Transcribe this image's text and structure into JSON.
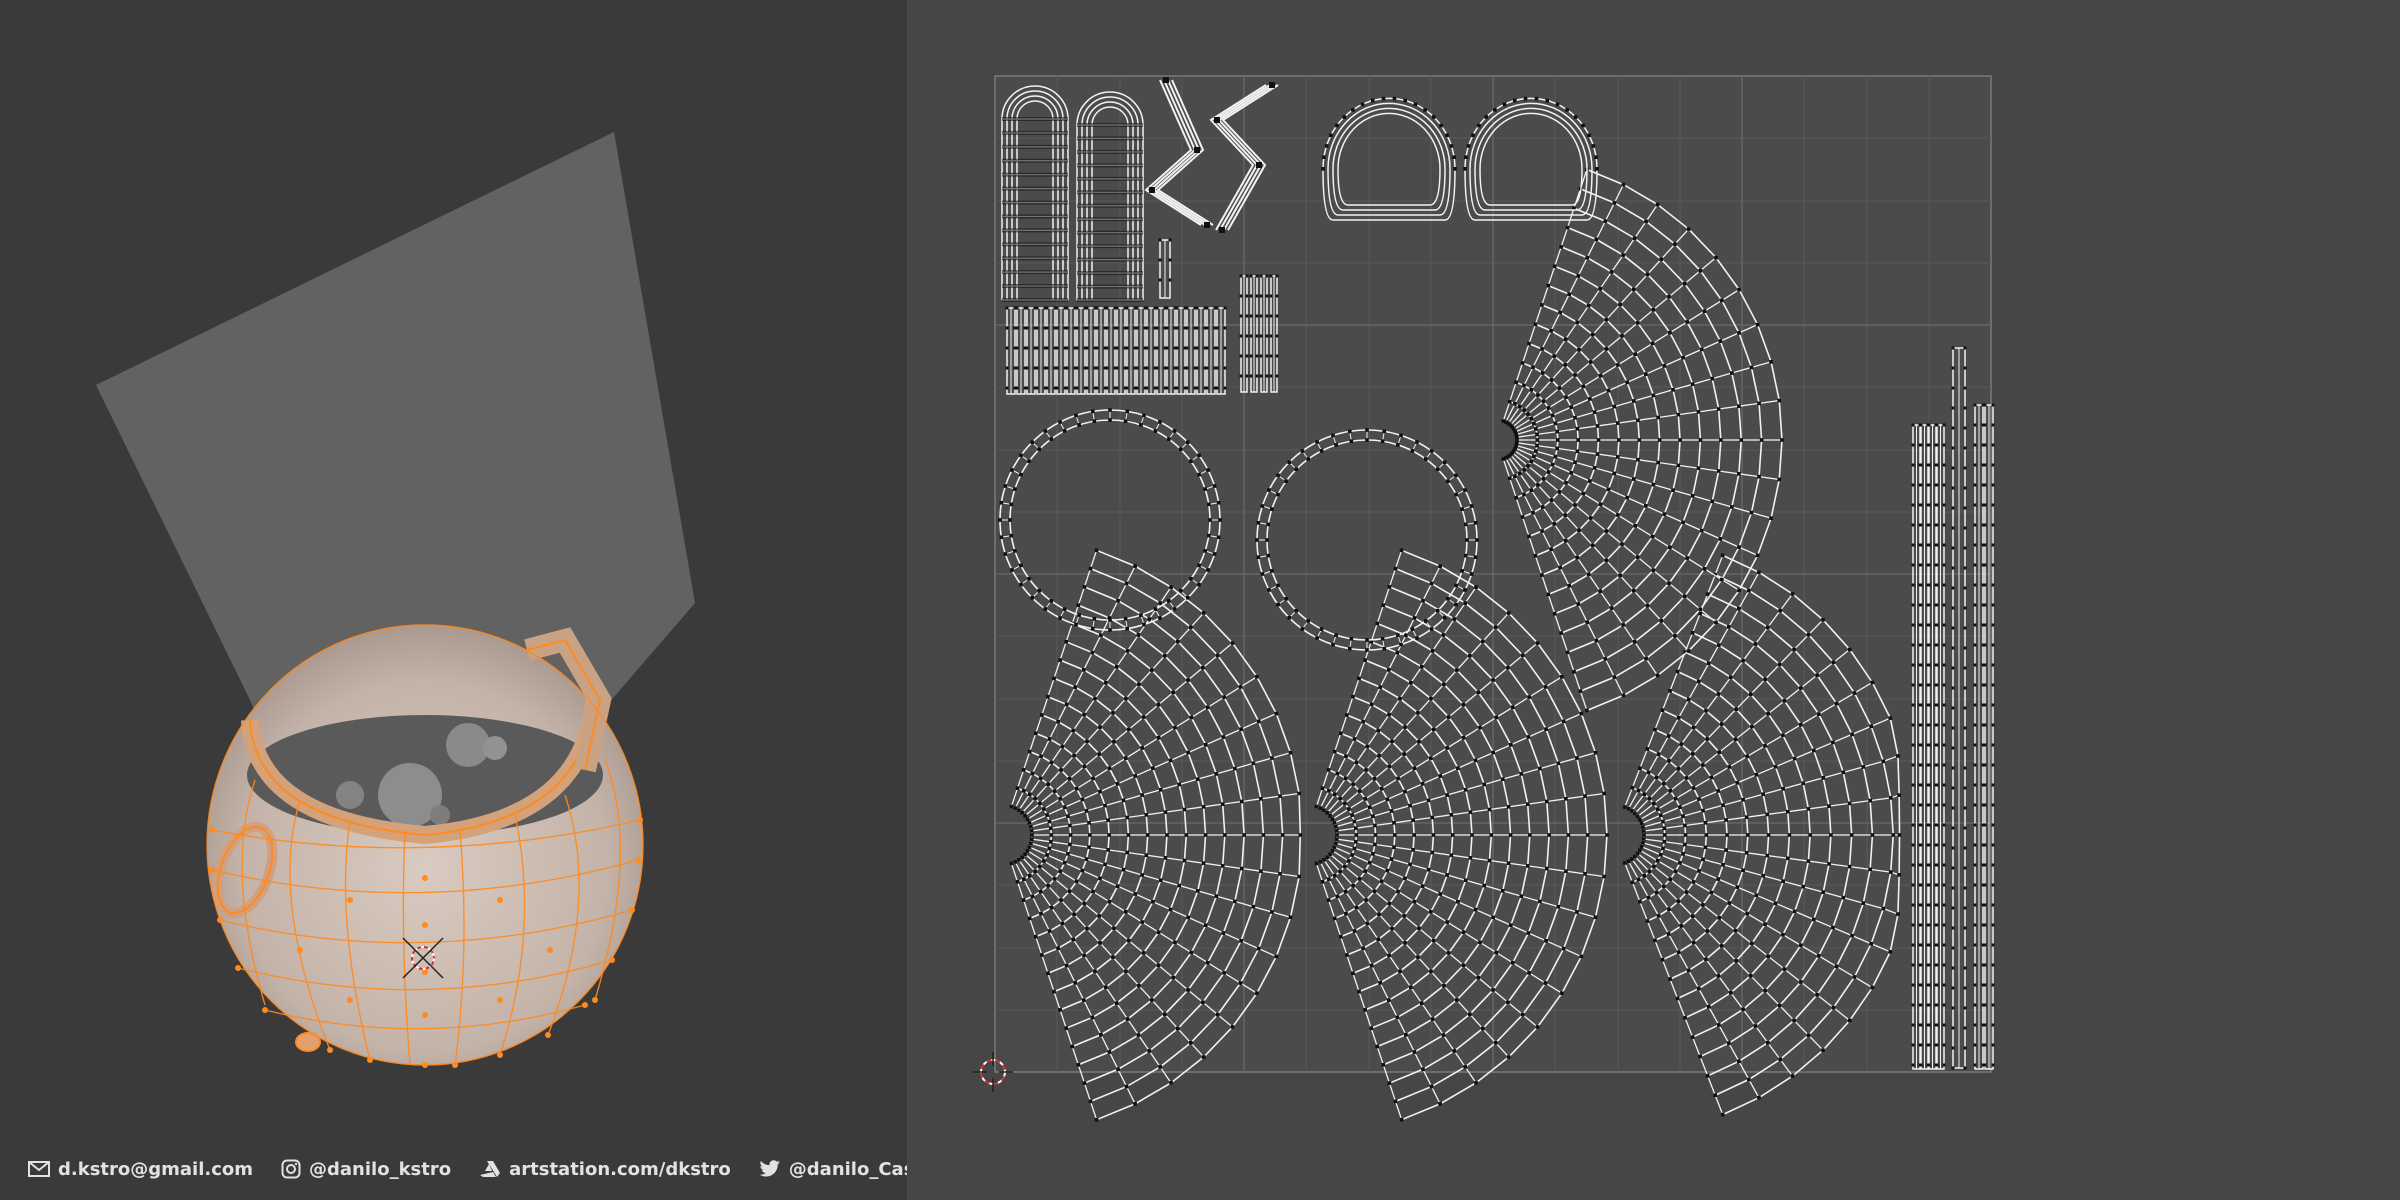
{
  "footer": {
    "email": "d.kstro@gmail.com",
    "instagram": "@danilo_kstro",
    "artstation": "artstation.com/dkstro",
    "twitter": "@danilo_Castro"
  },
  "icons": {
    "email": "mail-icon",
    "instagram": "instagram-icon",
    "artstation": "artstation-icon",
    "twitter": "twitter-icon",
    "cursor": "3d-cursor-icon"
  },
  "colors": {
    "viewport_bg": "#3a3a3a",
    "uv_bg": "#464646",
    "selection_orange": "#ff8a1f",
    "mesh_surface": "#c9bbb2",
    "uv_edge": "#ffffff",
    "uv_vertex": "#111111"
  }
}
